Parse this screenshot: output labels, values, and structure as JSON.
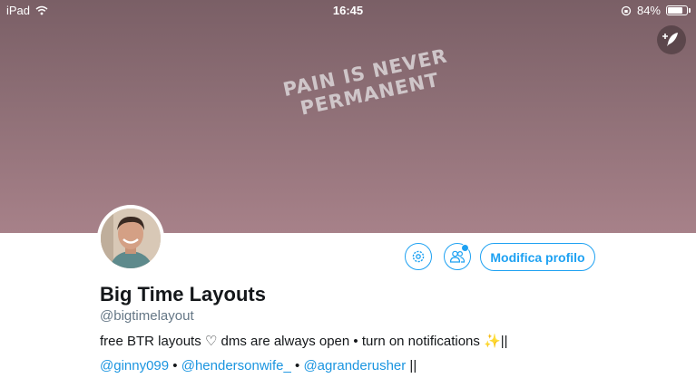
{
  "status_bar": {
    "device": "iPad",
    "time": "16:45",
    "battery_text": "84%",
    "battery_level": 0.84
  },
  "header": {
    "banner_text_line1": "PAIN IS NEVER",
    "banner_text_line2": "PERMANENT",
    "banner_colors": [
      "#7a5f66",
      "#a78189"
    ]
  },
  "profile": {
    "display_name": "Big Time Layouts",
    "handle": "@bigtimelayout",
    "bio_line1": "free BTR layouts ♡ dms are always open • turn on notifications ✨||",
    "mentions": [
      "@ginny099",
      "@hendersonwife_",
      "@agranderusher"
    ],
    "separator": " • ",
    "bio_line2_suffix": " ||",
    "edit_button_label": "Modifica profilo"
  },
  "icons": {
    "compose": "feather-plus-icon",
    "settings": "gear-icon",
    "people": "people-icon",
    "wifi": "wifi-icon",
    "battery": "battery-icon",
    "rotation_lock": "rotation-lock-icon"
  },
  "colors": {
    "accent": "#1da1f2",
    "mention": "#1b95e0",
    "text": "#14171a",
    "secondary_text": "#657786"
  }
}
